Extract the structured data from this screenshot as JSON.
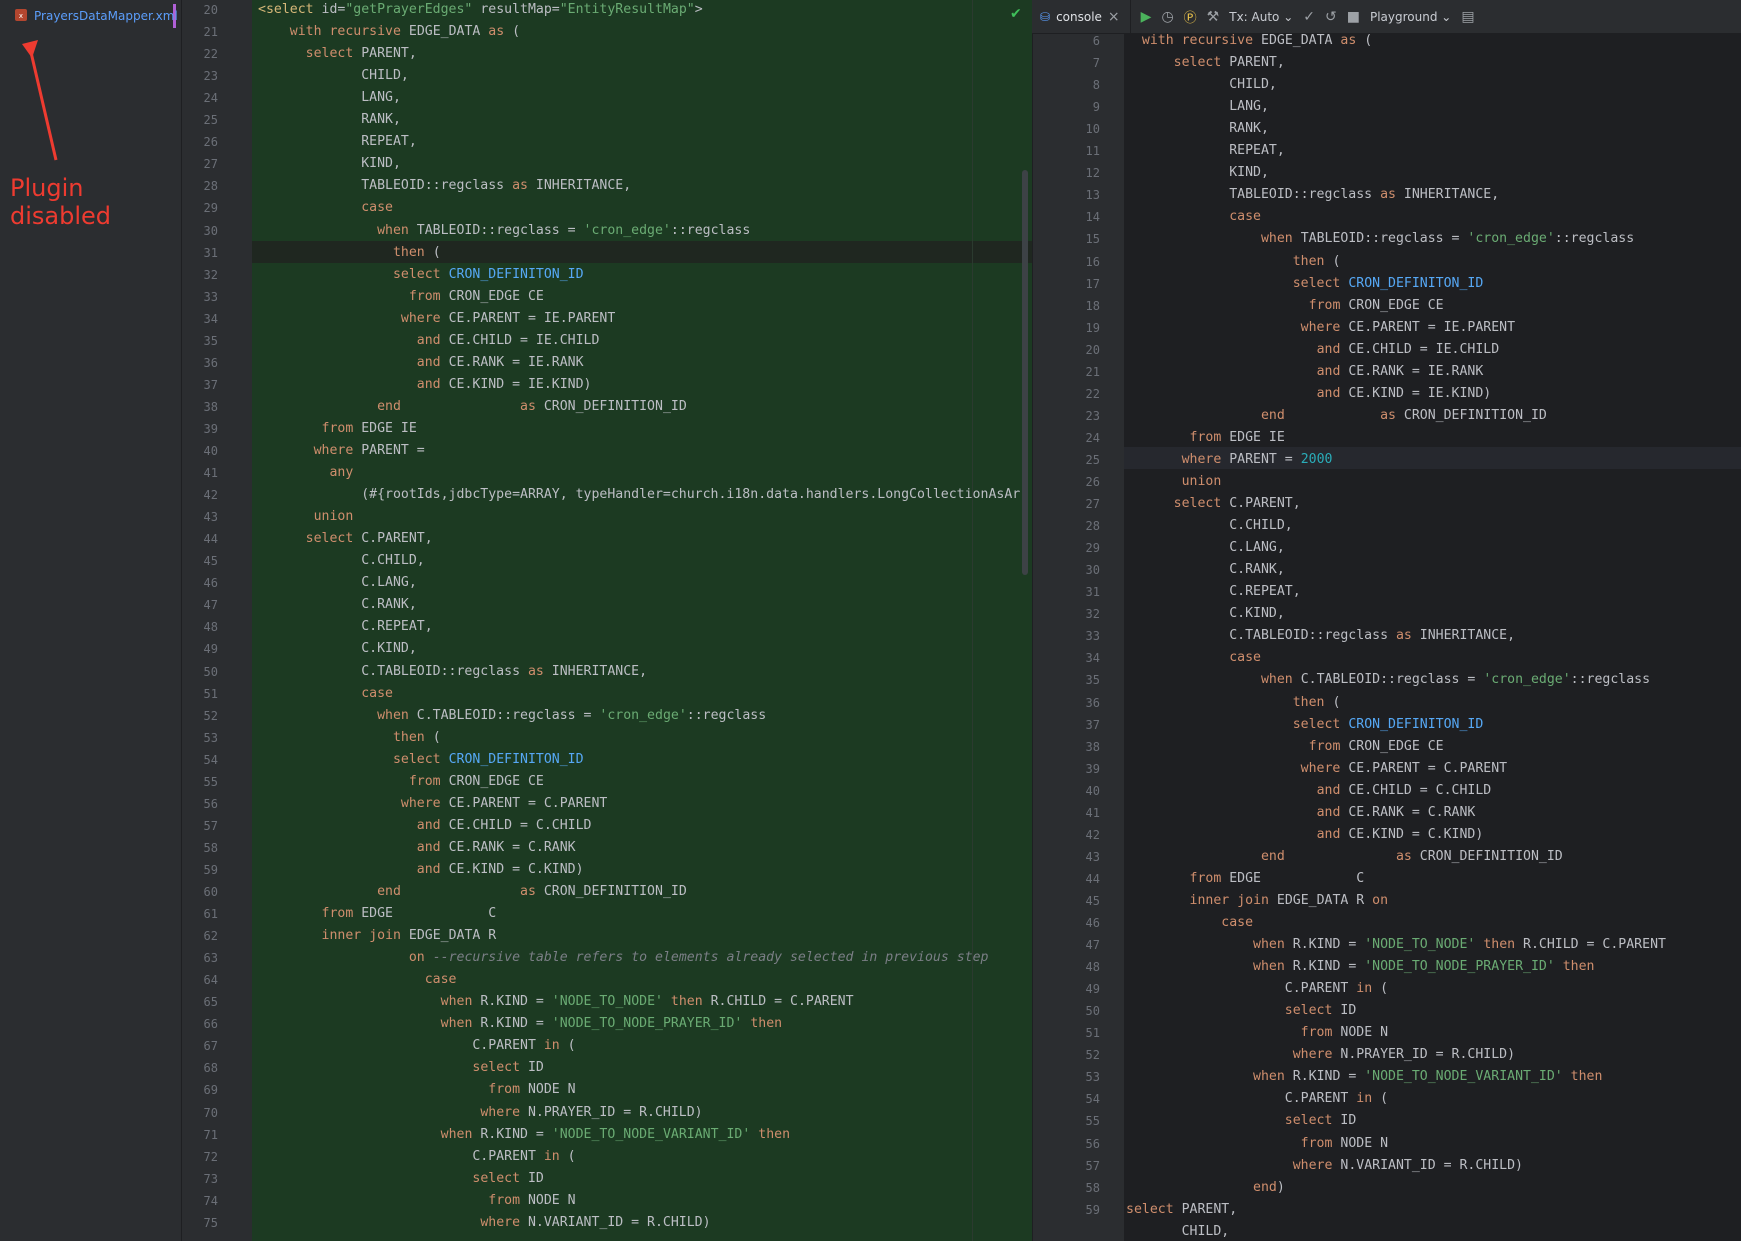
{
  "project": {
    "file_tab": "PrayersDataMapper.xml",
    "close": "×",
    "annotation": "Plugin disabled"
  },
  "left_editor": {
    "lines": [
      {
        "n": "20",
        "t": "<select id=\"getPrayerEdges\" resultMap=\"EntityResultMap\">"
      },
      {
        "n": "21",
        "t": "    with recursive EDGE_DATA as ("
      },
      {
        "n": "22",
        "t": "      select PARENT,"
      },
      {
        "n": "23",
        "t": "             CHILD,"
      },
      {
        "n": "24",
        "t": "             LANG,"
      },
      {
        "n": "25",
        "t": "             RANK,"
      },
      {
        "n": "26",
        "t": "             REPEAT,"
      },
      {
        "n": "27",
        "t": "             KIND,"
      },
      {
        "n": "28",
        "t": "             TABLEOID::regclass as INHERITANCE,"
      },
      {
        "n": "29",
        "t": "             case"
      },
      {
        "n": "30",
        "t": "               when TABLEOID::regclass = 'cron_edge'::regclass"
      },
      {
        "n": "31",
        "t": "                 then ("
      },
      {
        "n": "32",
        "t": "                 select CRON_DEFINITON_ID"
      },
      {
        "n": "33",
        "t": "                   from CRON_EDGE CE"
      },
      {
        "n": "34",
        "t": "                  where CE.PARENT = IE.PARENT"
      },
      {
        "n": "35",
        "t": "                    and CE.CHILD = IE.CHILD"
      },
      {
        "n": "36",
        "t": "                    and CE.RANK = IE.RANK"
      },
      {
        "n": "37",
        "t": "                    and CE.KIND = IE.KIND)"
      },
      {
        "n": "38",
        "t": "               end               as CRON_DEFINITION_ID"
      },
      {
        "n": "39",
        "t": "        from EDGE IE"
      },
      {
        "n": "40",
        "t": "       where PARENT ="
      },
      {
        "n": "41",
        "t": "         any"
      },
      {
        "n": "42",
        "t": "             (#{rootIds,jdbcType=ARRAY, typeHandler=church.i18n.data.handlers.LongCollectionAsAr"
      },
      {
        "n": "43",
        "t": "       union"
      },
      {
        "n": "44",
        "t": "      select C.PARENT,"
      },
      {
        "n": "45",
        "t": "             C.CHILD,"
      },
      {
        "n": "46",
        "t": "             C.LANG,"
      },
      {
        "n": "47",
        "t": "             C.RANK,"
      },
      {
        "n": "48",
        "t": "             C.REPEAT,"
      },
      {
        "n": "49",
        "t": "             C.KIND,"
      },
      {
        "n": "50",
        "t": "             C.TABLEOID::regclass as INHERITANCE,"
      },
      {
        "n": "51",
        "t": "             case"
      },
      {
        "n": "52",
        "t": "               when C.TABLEOID::regclass = 'cron_edge'::regclass"
      },
      {
        "n": "53",
        "t": "                 then ("
      },
      {
        "n": "54",
        "t": "                 select CRON_DEFINITON_ID"
      },
      {
        "n": "55",
        "t": "                   from CRON_EDGE CE"
      },
      {
        "n": "56",
        "t": "                  where CE.PARENT = C.PARENT"
      },
      {
        "n": "57",
        "t": "                    and CE.CHILD = C.CHILD"
      },
      {
        "n": "58",
        "t": "                    and CE.RANK = C.RANK"
      },
      {
        "n": "59",
        "t": "                    and CE.KIND = C.KIND)"
      },
      {
        "n": "60",
        "t": "               end               as CRON_DEFINITION_ID"
      },
      {
        "n": "61",
        "t": "        from EDGE            C"
      },
      {
        "n": "62",
        "t": "        inner join EDGE_DATA R"
      },
      {
        "n": "63",
        "t": "                   on --recursive table refers to elements already selected in previous step"
      },
      {
        "n": "64",
        "t": "                     case"
      },
      {
        "n": "65",
        "t": "                       when R.KIND = 'NODE_TO_NODE' then R.CHILD = C.PARENT"
      },
      {
        "n": "66",
        "t": "                       when R.KIND = 'NODE_TO_NODE_PRAYER_ID' then"
      },
      {
        "n": "67",
        "t": "                           C.PARENT in ("
      },
      {
        "n": "68",
        "t": "                           select ID"
      },
      {
        "n": "69",
        "t": "                             from NODE N"
      },
      {
        "n": "70",
        "t": "                            where N.PRAYER_ID = R.CHILD)"
      },
      {
        "n": "71",
        "t": "                       when R.KIND = 'NODE_TO_NODE_VARIANT_ID' then"
      },
      {
        "n": "72",
        "t": "                           C.PARENT in ("
      },
      {
        "n": "73",
        "t": "                           select ID"
      },
      {
        "n": "74",
        "t": "                             from NODE N"
      },
      {
        "n": "75",
        "t": "                            where N.VARIANT_ID = R.CHILD)"
      }
    ]
  },
  "right_toolbar": {
    "console_tab": "console",
    "tx_label": "Tx: Auto",
    "playground_label": "Playground"
  },
  "right_editor": {
    "lines": [
      {
        "n": "6",
        "t": "  with recursive EDGE_DATA as ("
      },
      {
        "n": "7",
        "t": "      select PARENT,"
      },
      {
        "n": "8",
        "t": "             CHILD,"
      },
      {
        "n": "9",
        "t": "             LANG,"
      },
      {
        "n": "10",
        "t": "             RANK,"
      },
      {
        "n": "11",
        "t": "             REPEAT,"
      },
      {
        "n": "12",
        "t": "             KIND,"
      },
      {
        "n": "13",
        "t": "             TABLEOID::regclass as INHERITANCE,"
      },
      {
        "n": "14",
        "t": "             case"
      },
      {
        "n": "15",
        "t": "                 when TABLEOID::regclass = 'cron_edge'::regclass"
      },
      {
        "n": "16",
        "t": "                     then ("
      },
      {
        "n": "17",
        "t": "                     select CRON_DEFINITON_ID"
      },
      {
        "n": "18",
        "t": "                       from CRON_EDGE CE"
      },
      {
        "n": "19",
        "t": "                      where CE.PARENT = IE.PARENT"
      },
      {
        "n": "20",
        "t": "                        and CE.CHILD = IE.CHILD"
      },
      {
        "n": "21",
        "t": "                        and CE.RANK = IE.RANK"
      },
      {
        "n": "22",
        "t": "                        and CE.KIND = IE.KIND)"
      },
      {
        "n": "23",
        "t": "                 end            as CRON_DEFINITION_ID"
      },
      {
        "n": "24",
        "t": "        from EDGE IE"
      },
      {
        "n": "25",
        "t": "       where PARENT = 2000"
      },
      {
        "n": "26",
        "t": "       union"
      },
      {
        "n": "27",
        "t": "      select C.PARENT,"
      },
      {
        "n": "28",
        "t": "             C.CHILD,"
      },
      {
        "n": "29",
        "t": "             C.LANG,"
      },
      {
        "n": "30",
        "t": "             C.RANK,"
      },
      {
        "n": "31",
        "t": "             C.REPEAT,"
      },
      {
        "n": "32",
        "t": "             C.KIND,"
      },
      {
        "n": "33",
        "t": "             C.TABLEOID::regclass as INHERITANCE,"
      },
      {
        "n": "34",
        "t": "             case"
      },
      {
        "n": "35",
        "t": "                 when C.TABLEOID::regclass = 'cron_edge'::regclass"
      },
      {
        "n": "36",
        "t": "                     then ("
      },
      {
        "n": "37",
        "t": "                     select CRON_DEFINITON_ID"
      },
      {
        "n": "38",
        "t": "                       from CRON_EDGE CE"
      },
      {
        "n": "39",
        "t": "                      where CE.PARENT = C.PARENT"
      },
      {
        "n": "40",
        "t": "                        and CE.CHILD = C.CHILD"
      },
      {
        "n": "41",
        "t": "                        and CE.RANK = C.RANK"
      },
      {
        "n": "42",
        "t": "                        and CE.KIND = C.KIND)"
      },
      {
        "n": "43",
        "t": "                 end              as CRON_DEFINITION_ID"
      },
      {
        "n": "44",
        "t": "        from EDGE            C"
      },
      {
        "n": "45",
        "t": "        inner join EDGE_DATA R on"
      },
      {
        "n": "46",
        "t": "            case"
      },
      {
        "n": "47",
        "t": "                when R.KIND = 'NODE_TO_NODE' then R.CHILD = C.PARENT"
      },
      {
        "n": "48",
        "t": "                when R.KIND = 'NODE_TO_NODE_PRAYER_ID' then"
      },
      {
        "n": "49",
        "t": "                    C.PARENT in ("
      },
      {
        "n": "50",
        "t": "                    select ID"
      },
      {
        "n": "51",
        "t": "                      from NODE N"
      },
      {
        "n": "52",
        "t": "                     where N.PRAYER_ID = R.CHILD)"
      },
      {
        "n": "53",
        "t": "                when R.KIND = 'NODE_TO_NODE_VARIANT_ID' then"
      },
      {
        "n": "54",
        "t": "                    C.PARENT in ("
      },
      {
        "n": "55",
        "t": "                    select ID"
      },
      {
        "n": "56",
        "t": "                      from NODE N"
      },
      {
        "n": "57",
        "t": "                     where N.VARIANT_ID = R.CHILD)"
      },
      {
        "n": "58",
        "t": "                end)"
      },
      {
        "n": "59",
        "t": "select PARENT,"
      },
      {
        "n": "",
        "t": "       CHILD,"
      }
    ]
  },
  "colors": {
    "accent": "#5b9dfa",
    "annotation": "#ee3b30",
    "xml_injected_bg": "#1c3a22"
  }
}
